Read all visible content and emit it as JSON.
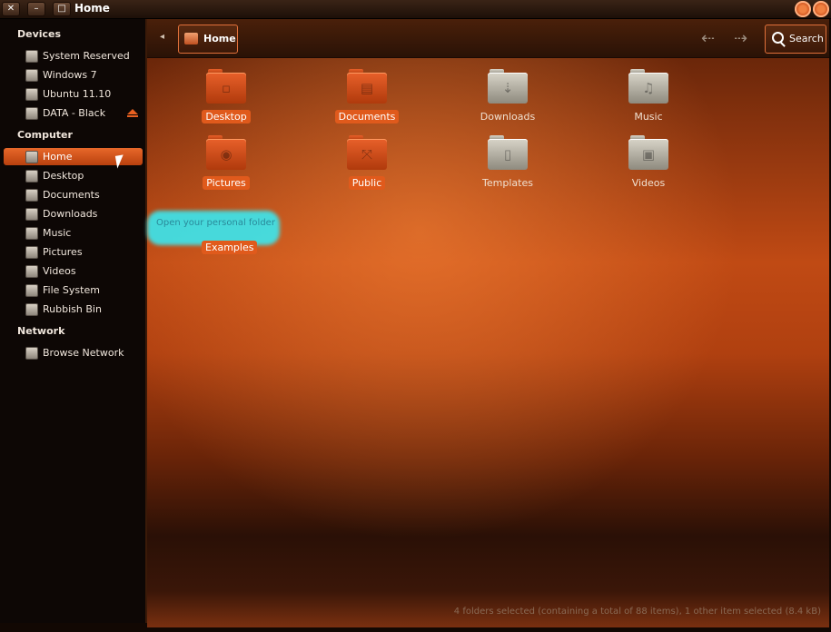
{
  "window": {
    "title": "Home"
  },
  "sidebar": {
    "devices_header": "Devices",
    "devices": [
      {
        "label": "System Reserved"
      },
      {
        "label": "Windows 7"
      },
      {
        "label": "Ubuntu 11.10"
      },
      {
        "label": "DATA - Black"
      }
    ],
    "computer_header": "Computer",
    "computer": [
      {
        "label": "Home"
      },
      {
        "label": "Desktop"
      },
      {
        "label": "Documents"
      },
      {
        "label": "Downloads"
      },
      {
        "label": "Music"
      },
      {
        "label": "Pictures"
      },
      {
        "label": "Videos"
      },
      {
        "label": "File System"
      },
      {
        "label": "Rubbish Bin"
      }
    ],
    "network_header": "Network",
    "network": [
      {
        "label": "Browse Network"
      }
    ]
  },
  "toolbar": {
    "breadcrumb": "Home",
    "search_label": "Search"
  },
  "files": [
    {
      "name": "Desktop"
    },
    {
      "name": "Documents"
    },
    {
      "name": "Downloads"
    },
    {
      "name": "Music"
    },
    {
      "name": "Pictures"
    },
    {
      "name": "Public"
    },
    {
      "name": "Templates"
    },
    {
      "name": "Videos"
    }
  ],
  "tooltip": "Open your personal folder",
  "examples_label": "Examples",
  "status_text": "4 folders selected (containing a total of 88 items), 1 other item selected (8.4 kB)"
}
